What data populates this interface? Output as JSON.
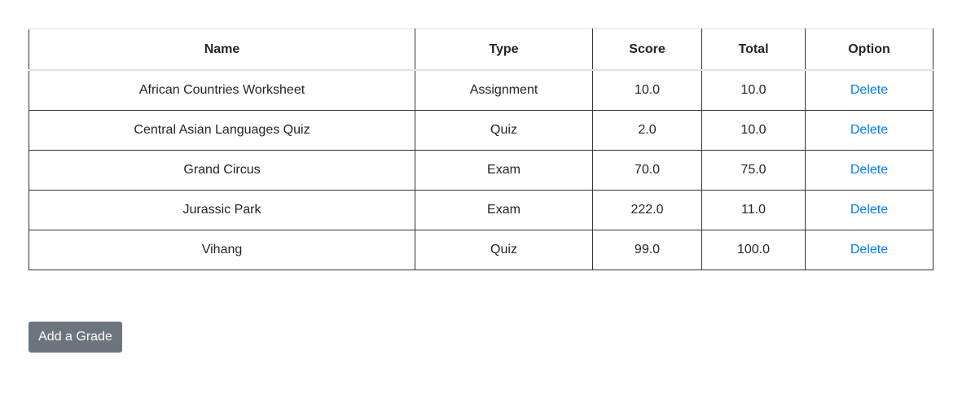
{
  "table": {
    "headers": [
      "Name",
      "Type",
      "Score",
      "Total",
      "Option"
    ],
    "rows": [
      {
        "name": "African Countries Worksheet",
        "type": "Assignment",
        "score": "10.0",
        "total": "10.0",
        "option": "Delete"
      },
      {
        "name": "Central Asian Languages Quiz",
        "type": "Quiz",
        "score": "2.0",
        "total": "10.0",
        "option": "Delete"
      },
      {
        "name": "Grand Circus",
        "type": "Exam",
        "score": "70.0",
        "total": "75.0",
        "option": "Delete"
      },
      {
        "name": "Jurassic Park",
        "type": "Exam",
        "score": "222.0",
        "total": "11.0",
        "option": "Delete"
      },
      {
        "name": "Vihang",
        "type": "Quiz",
        "score": "99.0",
        "total": "100.0",
        "option": "Delete"
      }
    ]
  },
  "add_button": {
    "label": "Add a Grade"
  },
  "colors": {
    "link": "#007bff",
    "button_bg": "#6c757d",
    "button_text": "#ffffff"
  }
}
